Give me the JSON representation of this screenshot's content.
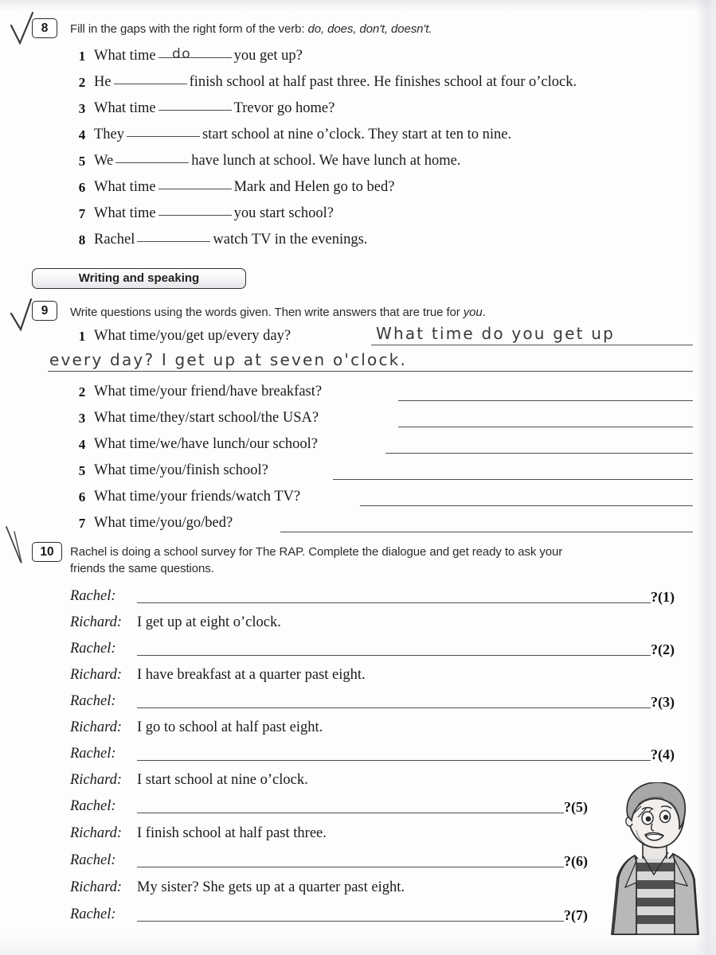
{
  "exercise8": {
    "number": "8",
    "instruction_prefix": "Fill in the gaps with the right form of the verb: ",
    "instruction_verbs": "do, does, don't, doesn't.",
    "items": [
      {
        "num": "1",
        "before": "What time",
        "after": "you get up?",
        "answer": "do"
      },
      {
        "num": "2",
        "before": "He",
        "after": "finish school at half past three. He finishes school at four o’clock.",
        "answer": ""
      },
      {
        "num": "3",
        "before": "What time",
        "after": "Trevor go home?",
        "answer": ""
      },
      {
        "num": "4",
        "before": "They",
        "after": "start school at nine o’clock. They start at ten to nine.",
        "answer": ""
      },
      {
        "num": "5",
        "before": "We",
        "after": "have lunch at school. We have lunch at home.",
        "answer": ""
      },
      {
        "num": "6",
        "before": "What time",
        "after": "Mark and Helen go to bed?",
        "answer": ""
      },
      {
        "num": "7",
        "before": "What time",
        "after": "you start school?",
        "answer": ""
      },
      {
        "num": "8",
        "before": "Rachel",
        "after": "watch TV in the evenings.",
        "answer": ""
      }
    ]
  },
  "section_banner": {
    "label": "Writing and speaking"
  },
  "exercise9": {
    "number": "9",
    "instruction_a": "Write questions using the words given. Then write answers that are true for ",
    "instruction_b": "you",
    "instruction_c": ".",
    "items": [
      {
        "num": "1",
        "prompt": "What time/you/get up/every day?"
      },
      {
        "num": "2",
        "prompt": "What time/your friend/have breakfast?"
      },
      {
        "num": "3",
        "prompt": "What time/they/start school/the USA?"
      },
      {
        "num": "4",
        "prompt": "What time/we/have lunch/our school?"
      },
      {
        "num": "5",
        "prompt": "What time/you/finish school?"
      },
      {
        "num": "6",
        "prompt": "What time/your friends/watch TV?"
      },
      {
        "num": "7",
        "prompt": "What time/you/go/bed?"
      }
    ],
    "handwritten_answer_line1": "What time do you get up",
    "handwritten_answer_line2": "every day? I get up at seven o'clock."
  },
  "exercise10": {
    "number": "10",
    "instruction_line1": "Rachel is doing a school survey for The RAP. Complete the dialogue and get ready to ask your",
    "instruction_line2": "friends the same questions.",
    "dialogue": [
      {
        "speaker": "Rachel:",
        "text": "",
        "marker": "?(1)"
      },
      {
        "speaker": "Richard:",
        "text": "I get up at eight o’clock.",
        "marker": ""
      },
      {
        "speaker": "Rachel:",
        "text": "",
        "marker": "?(2)"
      },
      {
        "speaker": "Richard:",
        "text": "I have breakfast at a quarter past eight.",
        "marker": ""
      },
      {
        "speaker": "Rachel:",
        "text": "",
        "marker": "?(3)"
      },
      {
        "speaker": "Richard:",
        "text": "I go to school at half past eight.",
        "marker": ""
      },
      {
        "speaker": "Rachel:",
        "text": "",
        "marker": "?(4)"
      },
      {
        "speaker": "Richard:",
        "text": "I start school at nine o’clock.",
        "marker": ""
      },
      {
        "speaker": "Rachel:",
        "text": "",
        "marker": "?(5)"
      },
      {
        "speaker": "Richard:",
        "text": "I finish school at half past three.",
        "marker": ""
      },
      {
        "speaker": "Rachel:",
        "text": "",
        "marker": "?(6)"
      },
      {
        "speaker": "Richard:",
        "text": "My sister? She gets up at a quarter past eight.",
        "marker": ""
      },
      {
        "speaker": "Rachel:",
        "text": "",
        "marker": "?(7)"
      }
    ]
  },
  "illustration": {
    "name": "boy-character",
    "skin": "#f2efed",
    "hair": "#a8a8a8",
    "jacket": "#b3b3b3",
    "stripe_dark": "#4f4f4f",
    "stripe_light": "#d6d6d6",
    "outline": "#2e2e2e"
  },
  "margin_marks": [
    {
      "name": "checkmark-exercise-8"
    },
    {
      "name": "checkmark-exercise-9"
    },
    {
      "name": "checkmark-exercise-10"
    }
  ]
}
